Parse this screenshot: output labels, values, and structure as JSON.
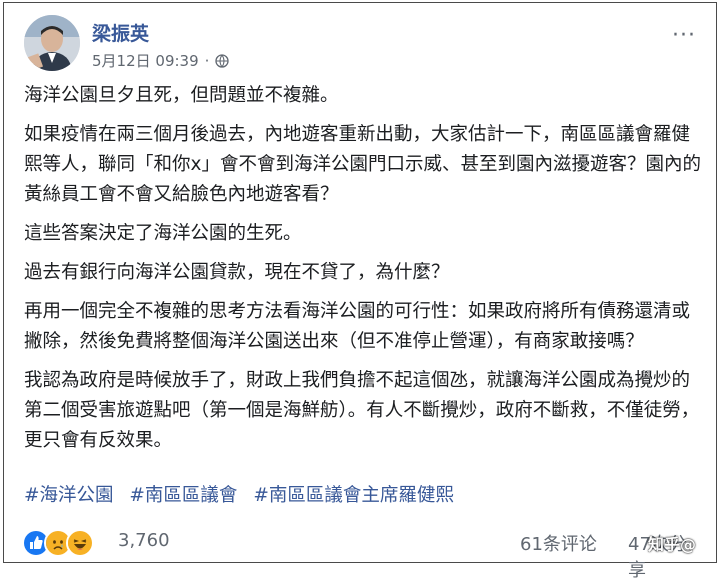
{
  "post": {
    "author": "梁振英",
    "timestamp": "5月12日 09:39",
    "separator": "·",
    "privacy_icon": "globe-icon",
    "more_icon": "more-options-icon",
    "more_label": "···",
    "paragraphs": [
      "海洋公園旦夕且死，但問題並不複雜。",
      "如果疫情在兩三個月後過去，內地遊客重新出動，大家估計一下，南區區議會羅健熙等人，聯同「和你x」會不會到海洋公園門口示威、甚至到園內滋擾遊客？園內的黃絲員工會不會又給臉色內地遊客看？",
      "這些答案決定了海洋公園的生死。",
      "過去有銀行向海洋公園貸款，現在不貸了，為什麼？",
      "再用一個完全不複雜的思考方法看海洋公園的可行性：如果政府將所有債務還清或撇除，然後免費將整個海洋公園送出來（但不准停止營運），有商家敢接嗎？",
      "我認為政府是時候放手了，財政上我們負擔不起這個氹，就讓海洋公園成為攪炒的第二個受害旅遊點吧（第一個是海鮮舫）。有人不斷攪炒，政府不斷救，不僅徒勞，更只會有反效果。"
    ],
    "hashtags": [
      "#海洋公園",
      "#南區區議會",
      "#南區區議會主席羅健熙"
    ]
  },
  "footer": {
    "reactions": [
      "like-reaction-icon",
      "sad-reaction-icon",
      "haha-reaction-icon"
    ],
    "reaction_count": "3,760",
    "comments": "61条评论",
    "shares": "47次分享",
    "watermark": "知乎@"
  },
  "colors": {
    "link": "#385898",
    "meta": "#606770",
    "like": "#1877f2",
    "emoji": "#f7b125"
  }
}
